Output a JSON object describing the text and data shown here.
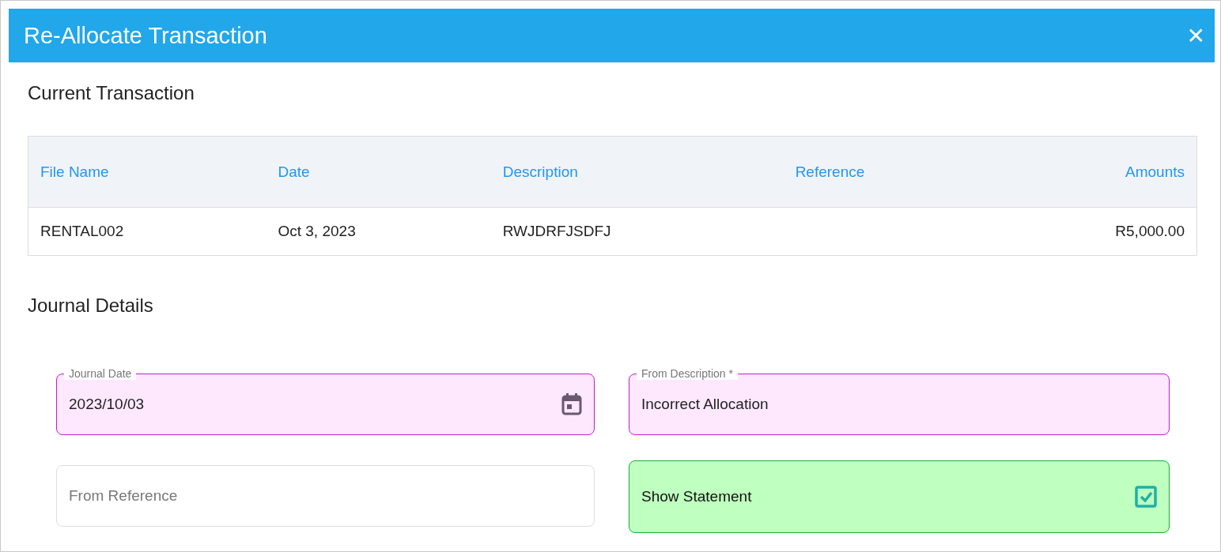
{
  "window": {
    "title": "Re-Allocate Transaction",
    "close": "✕"
  },
  "current": {
    "heading": "Current Transaction",
    "table": {
      "columns": [
        "File Name",
        "Date",
        "Description",
        "Reference",
        "Amounts"
      ],
      "rows": [
        [
          "RENTAL002",
          "Oct 3, 2023",
          "RWJDRFJSDFJ",
          "",
          "R5,000.00"
        ]
      ]
    }
  },
  "journal": {
    "heading": "Journal Details",
    "fields": [
      {
        "kind": "date",
        "label": "Journal Date",
        "value": "2023/10/03",
        "highlighted": true
      },
      {
        "kind": "text",
        "label": "From Description *",
        "value": "Incorrect Allocation",
        "highlighted": true
      },
      {
        "kind": "text",
        "placeholder": "From Reference",
        "highlighted": false
      },
      {
        "kind": "checkbox",
        "label": "Show Statement",
        "checked": true
      }
    ]
  }
}
